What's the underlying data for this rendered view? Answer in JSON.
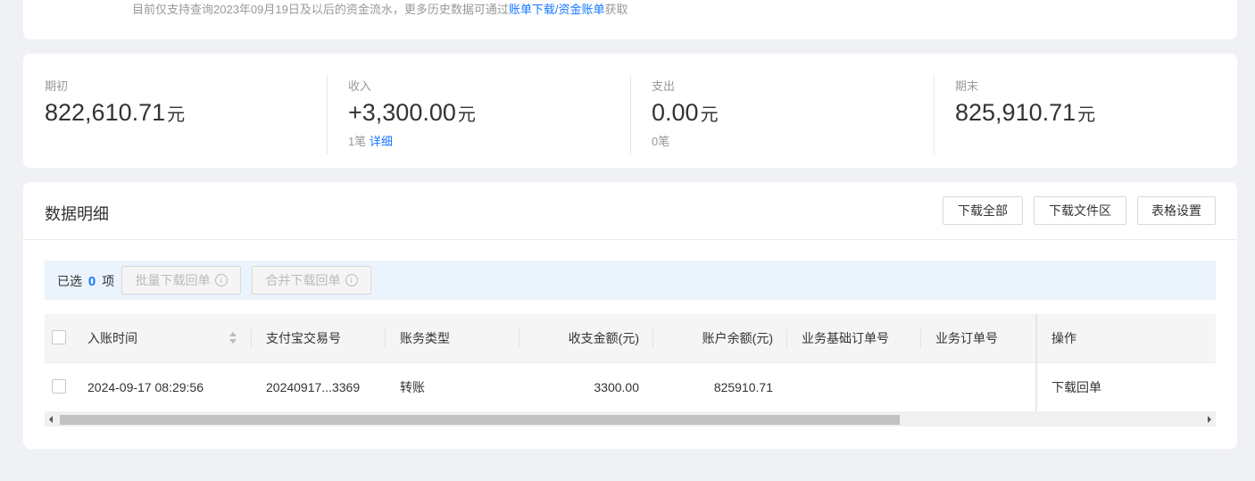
{
  "notice": {
    "prefix": "目前仅支持查询2023年09月19日及以后的资金流水，更多历史数据可通过",
    "link1": "账单下载",
    "slash": "/",
    "link2": "资金账单",
    "suffix": "获取"
  },
  "summary": {
    "items": [
      {
        "label": "期初",
        "amount": "822,610.71",
        "unit": "元",
        "count_text": "",
        "detail_link": ""
      },
      {
        "label": "收入",
        "amount": "+3,300.00",
        "unit": "元",
        "count_text": "1笔",
        "detail_link": "详细"
      },
      {
        "label": "支出",
        "amount": "0.00",
        "unit": "元",
        "count_text": "0笔",
        "detail_link": ""
      },
      {
        "label": "期末",
        "amount": "825,910.71",
        "unit": "元",
        "count_text": "",
        "detail_link": ""
      }
    ]
  },
  "detail": {
    "title": "数据明细",
    "buttons": {
      "download_all": "下载全部",
      "download_area": "下载文件区",
      "table_settings": "表格设置"
    },
    "selection": {
      "prefix": "已选",
      "count": "0",
      "suffix": "项",
      "batch_download": "批量下载回单",
      "merge_download": "合并下载回单",
      "info_glyph": "i"
    },
    "columns": [
      "入账时间",
      "支付宝交易号",
      "账务类型",
      "收支金额(元)",
      "账户余额(元)",
      "业务基础订单号",
      "业务订单号",
      "操作"
    ],
    "rows": [
      {
        "time": "2024-09-17 08:29:56",
        "trade_no": "20240917...3369",
        "type": "转账",
        "amount": "3300.00",
        "balance": "825910.71",
        "base_order_no": "",
        "order_no": "",
        "action": "下载回单"
      }
    ]
  },
  "colors": {
    "accent": "#1677ff",
    "page_bg": "#f0f1f5",
    "select_bar_bg": "#ebf3fd"
  },
  "icons": [
    "info-icon",
    "sort-icon",
    "checkbox",
    "scroll-arrow-left-icon",
    "scroll-arrow-right-icon"
  ]
}
